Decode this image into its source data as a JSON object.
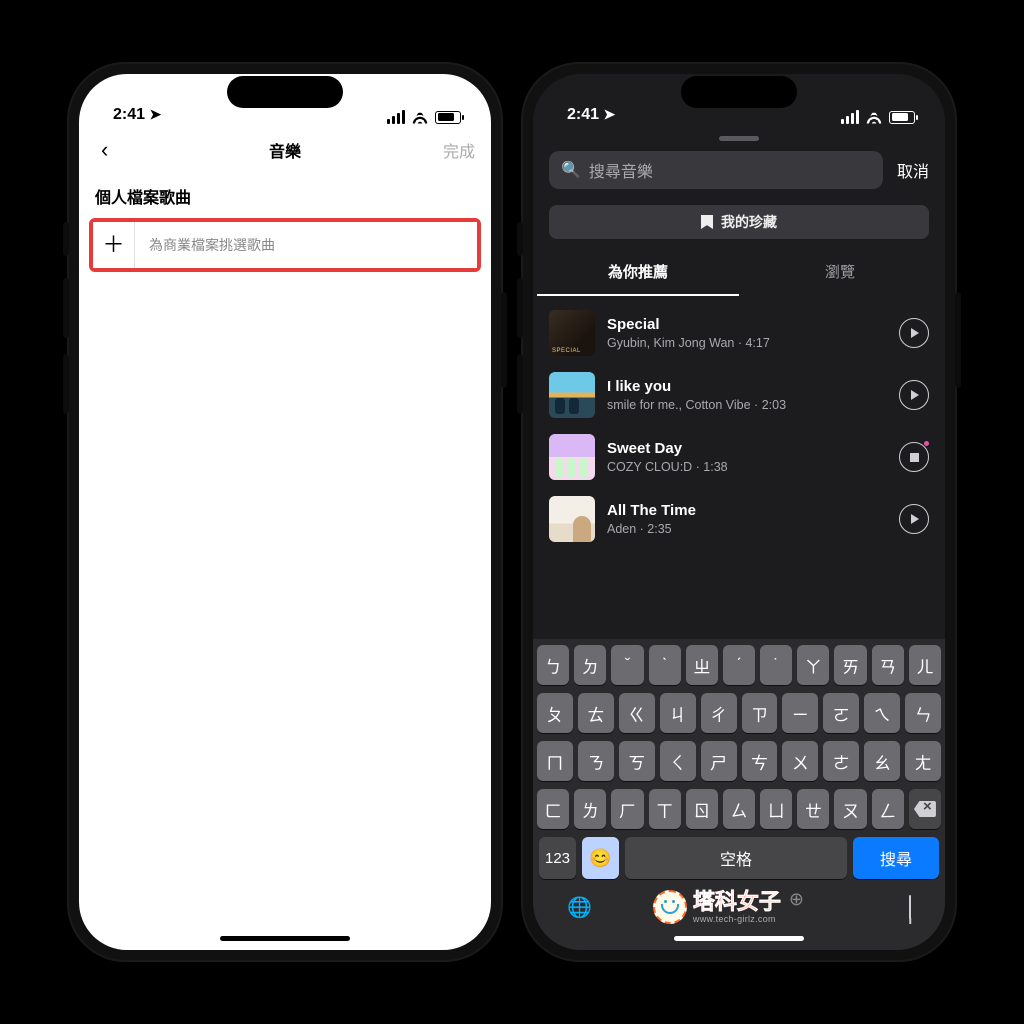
{
  "status": {
    "time": "2:41",
    "loc_glyph": "➤"
  },
  "left": {
    "nav": {
      "title": "音樂",
      "done": "完成"
    },
    "section_header": "個人檔案歌曲",
    "add_label": "為商業檔案挑選歌曲",
    "plus_glyph": "＋"
  },
  "right": {
    "search": {
      "placeholder": "搜尋音樂",
      "icon_glyph": "🔍"
    },
    "cancel": "取消",
    "saved": "我的珍藏",
    "tabs": {
      "recommended": "為你推薦",
      "browse": "瀏覽"
    },
    "songs": [
      {
        "title": "Special",
        "subtitle": "Gyubin, Kim Jong Wan · 4:17",
        "state": "play"
      },
      {
        "title": "I like you",
        "subtitle": "smile for me., Cotton Vibe · 2:03",
        "state": "play"
      },
      {
        "title": "Sweet Day",
        "subtitle": "COZY CLOU:D · 1:38",
        "state": "stop"
      },
      {
        "title": "All The Time",
        "subtitle": "Aden · 2:35",
        "state": "play"
      }
    ],
    "keyboard": {
      "rows": [
        [
          "ㄅ",
          "ㄉ",
          "ˇ",
          "ˋ",
          "ㄓ",
          "ˊ",
          "˙",
          "ㄚ",
          "ㄞ",
          "ㄢ",
          "ㄦ"
        ],
        [
          "ㄆ",
          "ㄊ",
          "ㄍ",
          "ㄐ",
          "ㄔ",
          "ㄗ",
          "ㄧ",
          "ㄛ",
          "ㄟ",
          "ㄣ"
        ],
        [
          "ㄇ",
          "ㄋ",
          "ㄎ",
          "ㄑ",
          "ㄕ",
          "ㄘ",
          "ㄨ",
          "ㄜ",
          "ㄠ",
          "ㄤ"
        ],
        [
          "ㄈ",
          "ㄌ",
          "ㄏ",
          "ㄒ",
          "ㄖ",
          "ㄙ",
          "ㄩ",
          "ㄝ",
          "ㄡ",
          "ㄥ"
        ]
      ],
      "k123": "123",
      "emoji": "😊",
      "space": "空格",
      "search": "搜尋",
      "globe": "🌐"
    }
  },
  "watermark": {
    "cn": "塔科女子",
    "en": "www.tech-girlz.com",
    "globe": "⊕"
  }
}
